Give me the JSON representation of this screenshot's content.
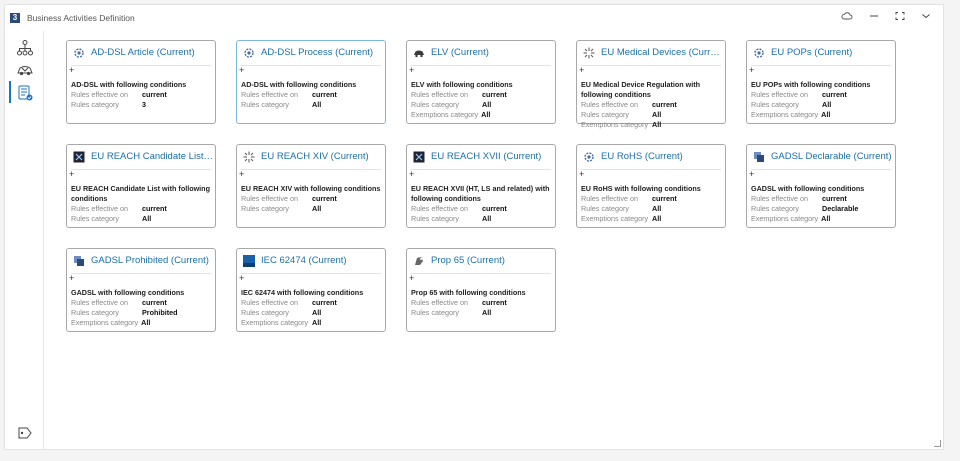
{
  "window": {
    "title": "Business Activities Definition"
  },
  "colors": {
    "accent": "#1a73c8",
    "title_link": "#1c6fa6"
  },
  "titlebar_controls": [
    "cloud-icon",
    "minimize-icon",
    "maximize-icon",
    "chevron-down-icon"
  ],
  "sidebar": {
    "items": [
      "tree-icon",
      "car-icon",
      "checklist-icon",
      "tag-icon"
    ],
    "active": "checklist-icon"
  },
  "cards": [
    {
      "title": "AD-DSL Article (Current)",
      "icon": "gear-icon",
      "plus": "+",
      "desc": "AD-DSL with following conditions",
      "rows": [
        {
          "k": "Rules effective on",
          "v": "current"
        },
        {
          "k": "Rules category",
          "v": "3"
        }
      ]
    },
    {
      "title": "AD-DSL Process (Current)",
      "icon": "gear-icon",
      "plus": "+",
      "desc": "AD-DSL with following conditions",
      "selected": true,
      "rows": [
        {
          "k": "Rules effective on",
          "v": "current"
        },
        {
          "k": "Rules category",
          "v": "All"
        }
      ]
    },
    {
      "title": "ELV (Current)",
      "icon": "car-icon",
      "plus": "+",
      "desc": "ELV with following conditions",
      "rows": [
        {
          "k": "Rules effective on",
          "v": "current"
        },
        {
          "k": "Rules category",
          "v": "All"
        },
        {
          "k": "Exemptions category",
          "v": "All",
          "exempt": true
        }
      ]
    },
    {
      "title": "EU Medical Devices (Current)",
      "icon": "sparkle-icon",
      "plus": "+",
      "desc": "EU Medical Device Regulation with following conditions",
      "rows": [
        {
          "k": "Rules effective on",
          "v": "current"
        },
        {
          "k": "Rules category",
          "v": "All"
        },
        {
          "k": "Exemptions category",
          "v": "All"
        }
      ]
    },
    {
      "title": "EU POPs (Current)",
      "icon": "gear-icon",
      "plus": "+",
      "desc": "EU POPs with following conditions",
      "rows": [
        {
          "k": "Rules effective on",
          "v": "current"
        },
        {
          "k": "Rules category",
          "v": "All"
        },
        {
          "k": "Exemptions category",
          "v": "All",
          "exempt": true
        }
      ]
    },
    {
      "title": "EU REACH Candidate List (Current)",
      "icon": "grid-icon",
      "plus": "+",
      "desc": "EU REACH Candidate List with following conditions",
      "rows": [
        {
          "k": "Rules effective on",
          "v": "current"
        },
        {
          "k": "Rules category",
          "v": "All"
        }
      ]
    },
    {
      "title": "EU REACH XIV (Current)",
      "icon": "sparkle-icon",
      "plus": "+",
      "desc": "EU REACH XIV with following conditions",
      "rows": [
        {
          "k": "Rules effective on",
          "v": "current"
        },
        {
          "k": "Rules category",
          "v": "All"
        }
      ]
    },
    {
      "title": "EU REACH XVII (Current)",
      "icon": "grid-icon",
      "plus": "+",
      "desc": "EU REACH XVII (HT, LS and related) with following conditions",
      "rows": [
        {
          "k": "Rules effective on",
          "v": "current"
        },
        {
          "k": "Rules category",
          "v": "All"
        }
      ]
    },
    {
      "title": "EU RoHS (Current)",
      "icon": "gear-icon",
      "plus": "+",
      "desc": "EU RoHS with following conditions",
      "rows": [
        {
          "k": "Rules effective on",
          "v": "current"
        },
        {
          "k": "Rules category",
          "v": "All"
        },
        {
          "k": "Exemptions category",
          "v": "All"
        }
      ]
    },
    {
      "title": "GADSL Declarable (Current)",
      "icon": "chip-icon",
      "plus": "+",
      "desc": "GADSL with following conditions",
      "rows": [
        {
          "k": "Rules effective on",
          "v": "current"
        },
        {
          "k": "Rules category",
          "v": "Declarable"
        },
        {
          "k": "Exemptions category",
          "v": "All",
          "exempt": true
        }
      ]
    },
    {
      "title": "GADSL Prohibited (Current)",
      "icon": "chip-icon",
      "plus": "+",
      "desc": "GADSL with following conditions",
      "rows": [
        {
          "k": "Rules effective on",
          "v": "current"
        },
        {
          "k": "Rules category",
          "v": "Prohibited"
        },
        {
          "k": "Exemptions category",
          "v": "All",
          "exempt": true
        }
      ]
    },
    {
      "title": "IEC 62474 (Current)",
      "icon": "iec-icon",
      "plus": "+",
      "desc": "IEC 62474 with following conditions",
      "rows": [
        {
          "k": "Rules effective on",
          "v": "current"
        },
        {
          "k": "Rules category",
          "v": "All"
        },
        {
          "k": "Exemptions category",
          "v": "All"
        }
      ]
    },
    {
      "title": "Prop 65 (Current)",
      "icon": "bear-icon",
      "plus": "+",
      "desc": "Prop 65 with following conditions",
      "rows": [
        {
          "k": "Rules effective on",
          "v": "current"
        },
        {
          "k": "Rules category",
          "v": "All"
        }
      ]
    }
  ]
}
